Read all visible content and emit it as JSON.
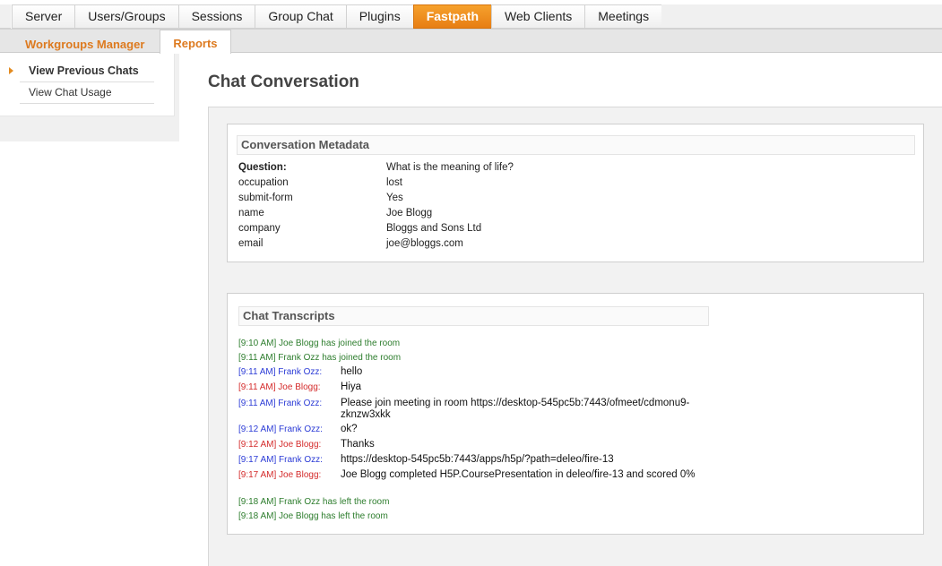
{
  "topnav": {
    "tabs": [
      "Server",
      "Users/Groups",
      "Sessions",
      "Group Chat",
      "Plugins",
      "Fastpath",
      "Web Clients",
      "Meetings"
    ],
    "active": "Fastpath"
  },
  "subnav": {
    "tabs": [
      "Workgroups Manager",
      "Reports"
    ],
    "active": "Reports"
  },
  "sidebar": {
    "items": [
      "View Previous Chats",
      "View Chat Usage"
    ],
    "active": "View Previous Chats"
  },
  "page_title": "Chat Conversation",
  "metadata": {
    "heading": "Conversation Metadata",
    "rows": [
      {
        "key": "Question:",
        "value": "What is the meaning of life?"
      },
      {
        "key": "occupation",
        "value": "lost"
      },
      {
        "key": "submit-form",
        "value": "Yes"
      },
      {
        "key": "name",
        "value": "Joe Blogg"
      },
      {
        "key": "company",
        "value": "Bloggs and Sons Ltd"
      },
      {
        "key": "email",
        "value": "joe@bloggs.com"
      }
    ]
  },
  "transcript": {
    "heading": "Chat Transcripts",
    "colors": {
      "system": "#2d7d2d",
      "agent": "#2b3bd6",
      "visitor": "#d42a2a"
    },
    "lines": [
      {
        "kind": "system",
        "time": "[9:10 AM]",
        "text": "Joe Blogg has joined the room"
      },
      {
        "kind": "system",
        "time": "[9:11 AM]",
        "text": "Frank Ozz has joined the room"
      },
      {
        "kind": "agent",
        "time": "[9:11 AM]",
        "speaker": "Frank Ozz:",
        "text": "hello"
      },
      {
        "kind": "visitor",
        "time": "[9:11 AM]",
        "speaker": "Joe Blogg:",
        "text": "Hiya"
      },
      {
        "kind": "agent",
        "time": "[9:11 AM]",
        "speaker": "Frank Ozz:",
        "text": "Please join meeting in room https://desktop-545pc5b:7443/ofmeet/cdmonu9-zknzw3xkk"
      },
      {
        "kind": "agent",
        "time": "[9:12 AM]",
        "speaker": "Frank Ozz:",
        "text": "ok?"
      },
      {
        "kind": "visitor",
        "time": "[9:12 AM]",
        "speaker": "Joe Blogg:",
        "text": "Thanks"
      },
      {
        "kind": "agent",
        "time": "[9:17 AM]",
        "speaker": "Frank Ozz:",
        "text": "https://desktop-545pc5b:7443/apps/h5p/?path=deleo/fire-13"
      },
      {
        "kind": "visitor",
        "time": "[9:17 AM]",
        "speaker": "Joe Blogg:",
        "text": "Joe Blogg completed H5P.CoursePresentation in deleo/fire-13 and scored 0%"
      },
      {
        "kind": "system",
        "time": "[9:18 AM]",
        "text": "Frank Ozz has left the room"
      },
      {
        "kind": "system",
        "time": "[9:18 AM]",
        "text": "Joe Blogg has left the room"
      }
    ]
  }
}
